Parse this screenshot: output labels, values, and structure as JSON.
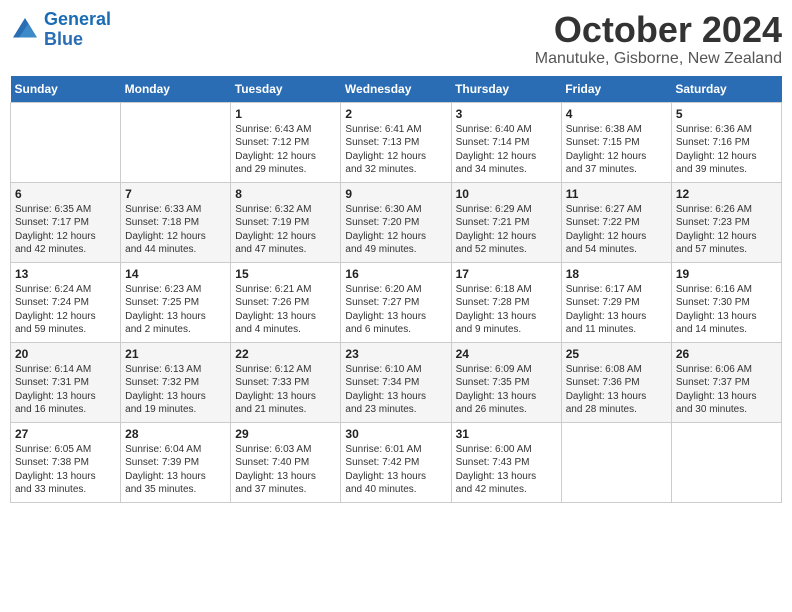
{
  "logo": {
    "line1": "General",
    "line2": "Blue"
  },
  "title": "October 2024",
  "location": "Manutuke, Gisborne, New Zealand",
  "weekdays": [
    "Sunday",
    "Monday",
    "Tuesday",
    "Wednesday",
    "Thursday",
    "Friday",
    "Saturday"
  ],
  "weeks": [
    [
      {
        "day": "",
        "info": ""
      },
      {
        "day": "",
        "info": ""
      },
      {
        "day": "1",
        "info": "Sunrise: 6:43 AM\nSunset: 7:12 PM\nDaylight: 12 hours\nand 29 minutes."
      },
      {
        "day": "2",
        "info": "Sunrise: 6:41 AM\nSunset: 7:13 PM\nDaylight: 12 hours\nand 32 minutes."
      },
      {
        "day": "3",
        "info": "Sunrise: 6:40 AM\nSunset: 7:14 PM\nDaylight: 12 hours\nand 34 minutes."
      },
      {
        "day": "4",
        "info": "Sunrise: 6:38 AM\nSunset: 7:15 PM\nDaylight: 12 hours\nand 37 minutes."
      },
      {
        "day": "5",
        "info": "Sunrise: 6:36 AM\nSunset: 7:16 PM\nDaylight: 12 hours\nand 39 minutes."
      }
    ],
    [
      {
        "day": "6",
        "info": "Sunrise: 6:35 AM\nSunset: 7:17 PM\nDaylight: 12 hours\nand 42 minutes."
      },
      {
        "day": "7",
        "info": "Sunrise: 6:33 AM\nSunset: 7:18 PM\nDaylight: 12 hours\nand 44 minutes."
      },
      {
        "day": "8",
        "info": "Sunrise: 6:32 AM\nSunset: 7:19 PM\nDaylight: 12 hours\nand 47 minutes."
      },
      {
        "day": "9",
        "info": "Sunrise: 6:30 AM\nSunset: 7:20 PM\nDaylight: 12 hours\nand 49 minutes."
      },
      {
        "day": "10",
        "info": "Sunrise: 6:29 AM\nSunset: 7:21 PM\nDaylight: 12 hours\nand 52 minutes."
      },
      {
        "day": "11",
        "info": "Sunrise: 6:27 AM\nSunset: 7:22 PM\nDaylight: 12 hours\nand 54 minutes."
      },
      {
        "day": "12",
        "info": "Sunrise: 6:26 AM\nSunset: 7:23 PM\nDaylight: 12 hours\nand 57 minutes."
      }
    ],
    [
      {
        "day": "13",
        "info": "Sunrise: 6:24 AM\nSunset: 7:24 PM\nDaylight: 12 hours\nand 59 minutes."
      },
      {
        "day": "14",
        "info": "Sunrise: 6:23 AM\nSunset: 7:25 PM\nDaylight: 13 hours\nand 2 minutes."
      },
      {
        "day": "15",
        "info": "Sunrise: 6:21 AM\nSunset: 7:26 PM\nDaylight: 13 hours\nand 4 minutes."
      },
      {
        "day": "16",
        "info": "Sunrise: 6:20 AM\nSunset: 7:27 PM\nDaylight: 13 hours\nand 6 minutes."
      },
      {
        "day": "17",
        "info": "Sunrise: 6:18 AM\nSunset: 7:28 PM\nDaylight: 13 hours\nand 9 minutes."
      },
      {
        "day": "18",
        "info": "Sunrise: 6:17 AM\nSunset: 7:29 PM\nDaylight: 13 hours\nand 11 minutes."
      },
      {
        "day": "19",
        "info": "Sunrise: 6:16 AM\nSunset: 7:30 PM\nDaylight: 13 hours\nand 14 minutes."
      }
    ],
    [
      {
        "day": "20",
        "info": "Sunrise: 6:14 AM\nSunset: 7:31 PM\nDaylight: 13 hours\nand 16 minutes."
      },
      {
        "day": "21",
        "info": "Sunrise: 6:13 AM\nSunset: 7:32 PM\nDaylight: 13 hours\nand 19 minutes."
      },
      {
        "day": "22",
        "info": "Sunrise: 6:12 AM\nSunset: 7:33 PM\nDaylight: 13 hours\nand 21 minutes."
      },
      {
        "day": "23",
        "info": "Sunrise: 6:10 AM\nSunset: 7:34 PM\nDaylight: 13 hours\nand 23 minutes."
      },
      {
        "day": "24",
        "info": "Sunrise: 6:09 AM\nSunset: 7:35 PM\nDaylight: 13 hours\nand 26 minutes."
      },
      {
        "day": "25",
        "info": "Sunrise: 6:08 AM\nSunset: 7:36 PM\nDaylight: 13 hours\nand 28 minutes."
      },
      {
        "day": "26",
        "info": "Sunrise: 6:06 AM\nSunset: 7:37 PM\nDaylight: 13 hours\nand 30 minutes."
      }
    ],
    [
      {
        "day": "27",
        "info": "Sunrise: 6:05 AM\nSunset: 7:38 PM\nDaylight: 13 hours\nand 33 minutes."
      },
      {
        "day": "28",
        "info": "Sunrise: 6:04 AM\nSunset: 7:39 PM\nDaylight: 13 hours\nand 35 minutes."
      },
      {
        "day": "29",
        "info": "Sunrise: 6:03 AM\nSunset: 7:40 PM\nDaylight: 13 hours\nand 37 minutes."
      },
      {
        "day": "30",
        "info": "Sunrise: 6:01 AM\nSunset: 7:42 PM\nDaylight: 13 hours\nand 40 minutes."
      },
      {
        "day": "31",
        "info": "Sunrise: 6:00 AM\nSunset: 7:43 PM\nDaylight: 13 hours\nand 42 minutes."
      },
      {
        "day": "",
        "info": ""
      },
      {
        "day": "",
        "info": ""
      }
    ]
  ]
}
